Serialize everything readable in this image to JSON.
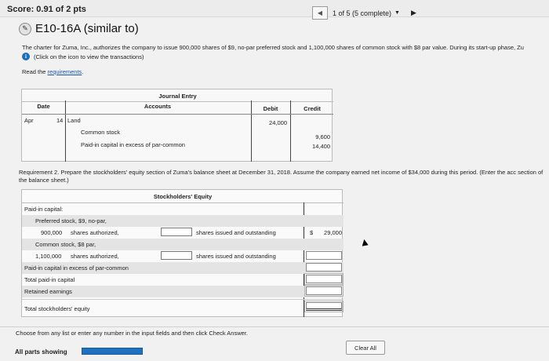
{
  "header": {
    "score": "Score: 0.91 of 2 pts",
    "progress_text": "1 of 5 (5 complete)",
    "dropdown": "▼",
    "prev": "◀",
    "next": "▶"
  },
  "problem": {
    "title": "E10-16A (similar to)",
    "description": "The charter for Zuma, Inc., authorizes the company to issue 900,000 shares of $9, no-par preferred stock and 1,100,000 shares of common stock with $8 par value. During its start-up phase, Zu",
    "click_note": "(Click on the icon to view the transactions)",
    "read_prefix": "Read the ",
    "read_link": "requirements",
    "read_suffix": "."
  },
  "journal": {
    "title": "Journal Entry",
    "columns": {
      "date": "Date",
      "accounts": "Accounts",
      "debit": "Debit",
      "credit": "Credit"
    },
    "rows": [
      {
        "month": "Apr",
        "day": "14",
        "account": "Land",
        "debit": "24,000",
        "credit": ""
      },
      {
        "month": "",
        "day": "",
        "account": "Common stock",
        "debit": "",
        "credit": "9,600"
      },
      {
        "month": "",
        "day": "",
        "account": "Paid-in capital in excess of par-common",
        "debit": "",
        "credit": "14,400"
      }
    ]
  },
  "requirement2": "Requirement 2. Prepare the stockholders' equity section of Zuma's balance sheet at December 31, 2018. Assume the company earned net income of $34,000 during this period. (Enter the acc section of the balance sheet.)",
  "equity": {
    "title": "Stockholders' Equity",
    "paid_in": "Paid-in capital:",
    "pref_stock": "Preferred stock, $9, no-par,",
    "pref_auth_num": "900,000",
    "pref_auth_label": "shares authorized,",
    "pref_issued_label": "shares issued and outstanding",
    "pref_dollar": "$",
    "pref_value": "29,000",
    "common_stock": "Common stock, $8 par,",
    "common_auth_num": "1,100,000",
    "common_auth_label": "shares authorized,",
    "common_issued_label": "shares issued and outstanding",
    "excess": "Paid-in capital in excess of par-common",
    "total_paid_in": "Total paid-in capital",
    "retained": "Retained earnings",
    "total_equity": "Total stockholders' equity"
  },
  "footer": {
    "instruction": "Choose from any list or enter any number in the input fields and then click Check Answer.",
    "clear_all": "Clear All",
    "all_parts": "All parts showing"
  },
  "colors": {
    "progress_bar": "#2070c0",
    "link": "#1a56b0",
    "info_icon": "#1b6fb7"
  }
}
